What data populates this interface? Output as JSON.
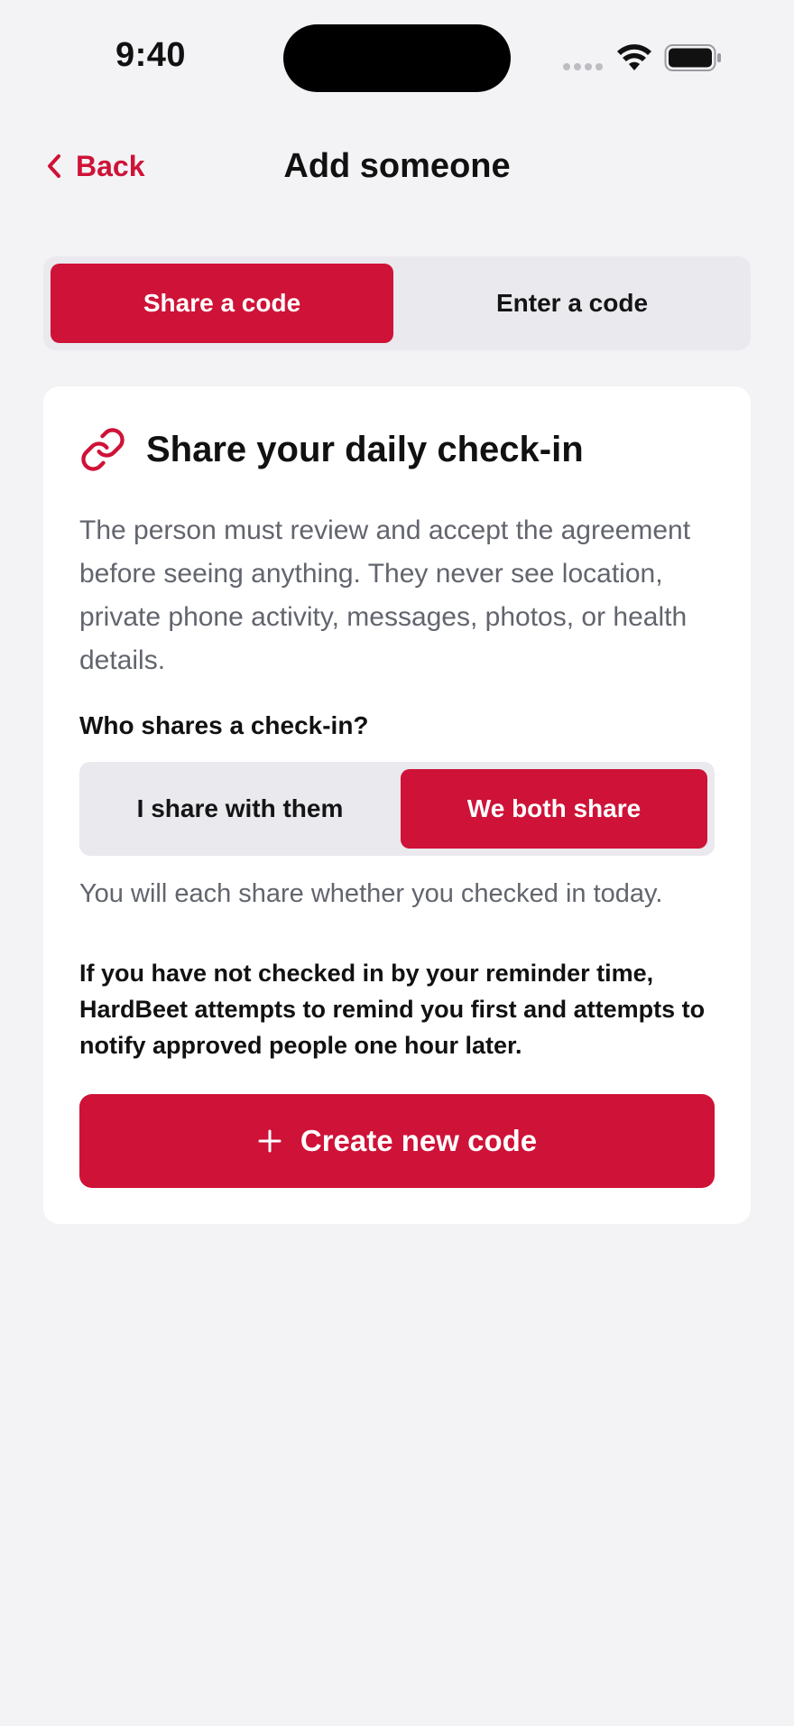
{
  "status_bar": {
    "time": "9:40"
  },
  "nav": {
    "back_label": "Back",
    "title": "Add someone"
  },
  "mode_tabs": {
    "share_label": "Share a code",
    "enter_label": "Enter a code",
    "selected": "Share a code"
  },
  "card": {
    "icon": "link-icon",
    "title": "Share your daily check-in",
    "description": "The person must review and accept the agreement before seeing anything. They never see location, private phone activity, messages, photos, or health details.",
    "question": "Who shares a check-in?",
    "share_options": {
      "option_one": "I share with them",
      "option_two": "We both share",
      "selected": "We both share"
    },
    "share_caption": "You will each share whether you checked in today.",
    "reminder_note": "If you have not checked in by your reminder time, HardBeet attempts to remind you first and attempts to notify approved people one hour later.",
    "create_button_label": "Create new code",
    "create_button_icon": "plus-icon"
  },
  "colors": {
    "accent": "#cf1237",
    "background": "#f3f3f6",
    "card": "#ffffff",
    "segment_track": "#e9e9ee",
    "secondary_text": "#62656d"
  }
}
